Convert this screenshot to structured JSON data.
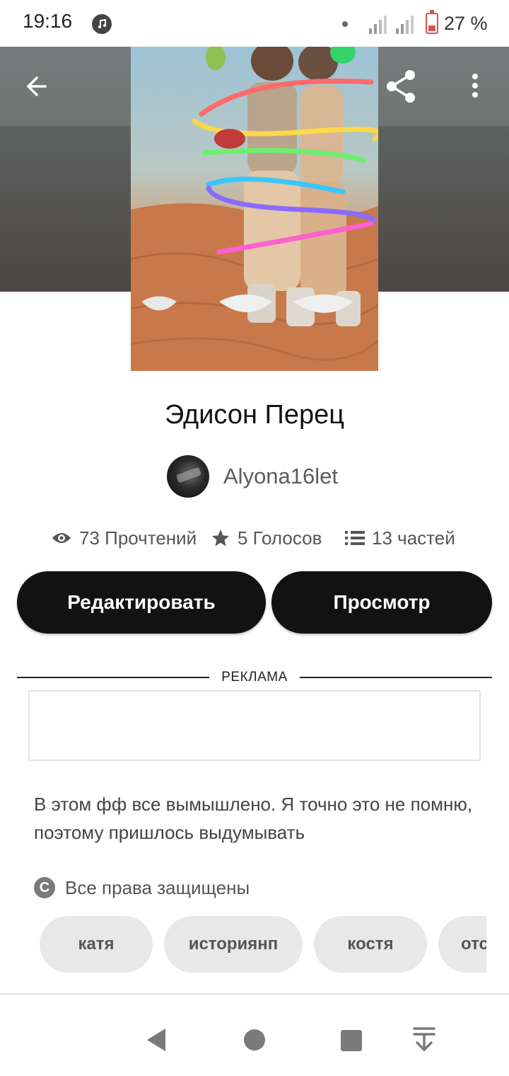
{
  "status_bar": {
    "time": "19:16",
    "battery": "27 %",
    "icons": [
      "music-icon",
      "signal-icon",
      "signal-icon",
      "battery-icon"
    ]
  },
  "header": {
    "back_icon": "arrow-left-icon",
    "share_icon": "share-icon",
    "more_icon": "more-vertical-icon",
    "cover_icon": "story-cover-image"
  },
  "story": {
    "title": "Эдисон Перец",
    "author": "Alyona16let",
    "description": "В этом фф все вымышлено. Я точно это не помню, поэтому пришлось выдумывать",
    "copyright": "Все права защищены"
  },
  "stats": {
    "reads": "73 Прочтений",
    "votes": "5 Голосов",
    "parts": "13 частей"
  },
  "actions": {
    "edit_label": "Редактировать",
    "preview_label": "Просмотр"
  },
  "ad": {
    "label": "РЕКЛАМА"
  },
  "tags": [
    "катя",
    "историянп",
    "костя",
    "отс"
  ],
  "colors": {
    "button_bg": "#121212",
    "tag_bg": "#e8e8e8",
    "text_muted": "#555555"
  },
  "nav": {
    "icons": [
      "triangle-back-icon",
      "circle-home-icon",
      "square-recents-icon",
      "collapse-down-icon"
    ]
  }
}
